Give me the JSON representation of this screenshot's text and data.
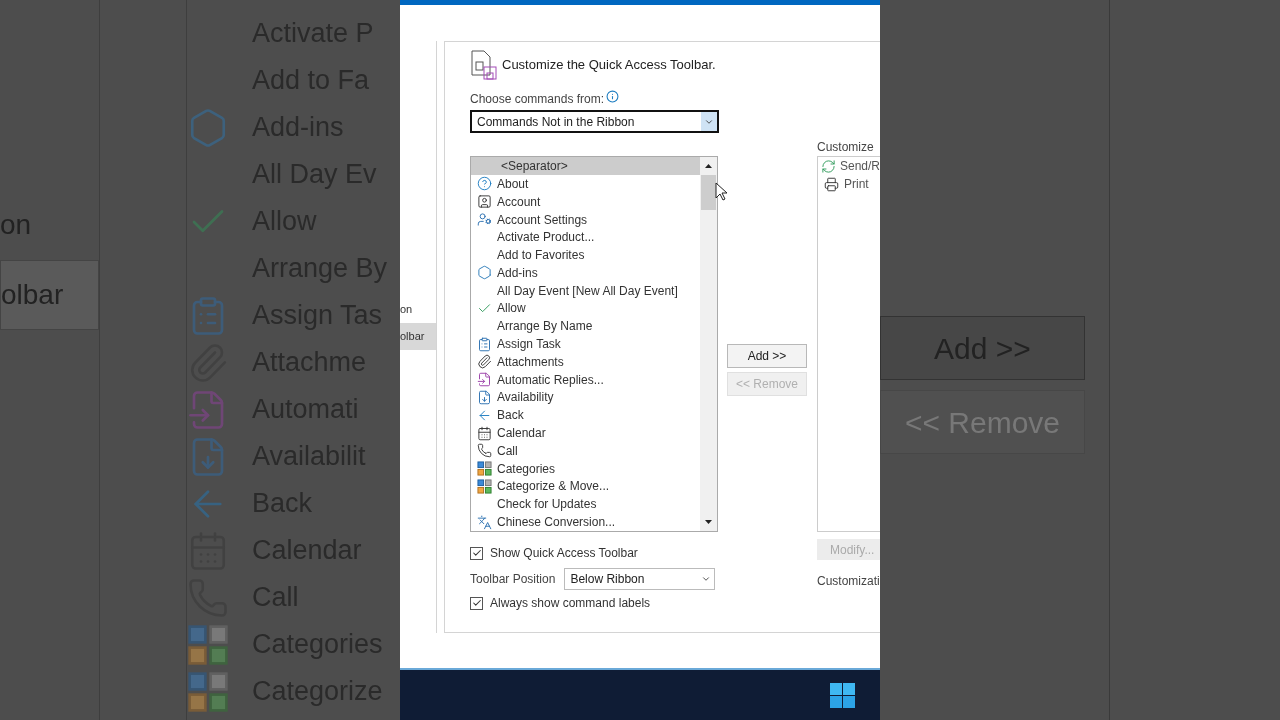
{
  "backdrop_left": {
    "nav_items": [
      {
        "label": "on",
        "selected": false
      },
      {
        "label": "olbar",
        "selected": true
      }
    ],
    "commands": [
      {
        "kind": "none",
        "label": "Activate P"
      },
      {
        "kind": "none",
        "label": "Add to Fa"
      },
      {
        "kind": "addin",
        "label": "Add-ins"
      },
      {
        "kind": "none",
        "label": "All Day Ev"
      },
      {
        "kind": "check",
        "label": "Allow"
      },
      {
        "kind": "none",
        "label": "Arrange By"
      },
      {
        "kind": "assign",
        "label": "Assign Tas"
      },
      {
        "kind": "clip",
        "label": "Attachme"
      },
      {
        "kind": "reply",
        "label": "Automati"
      },
      {
        "kind": "availability",
        "label": "Availabilit"
      },
      {
        "kind": "back",
        "label": "Back"
      },
      {
        "kind": "calendar",
        "label": "Calendar"
      },
      {
        "kind": "call",
        "label": "Call"
      },
      {
        "kind": "categories",
        "label": "Categories"
      },
      {
        "kind": "categories",
        "label": "Categorize"
      }
    ]
  },
  "dialog": {
    "nav_items": [
      {
        "label": "on",
        "selected": false
      },
      {
        "label": "olbar",
        "selected": true
      }
    ],
    "title": "Customize the Quick Access Toolbar.",
    "choose_label": "Choose commands from:",
    "choose_value": "Commands Not in the Ribbon",
    "commands": [
      {
        "kind": "none",
        "label": "<Separator>",
        "selected": true
      },
      {
        "kind": "help",
        "label": "About",
        "selected": false
      },
      {
        "kind": "person",
        "label": "Account",
        "selected": false
      },
      {
        "kind": "person-gear",
        "label": "Account Settings",
        "selected": false
      },
      {
        "kind": "none",
        "label": "Activate Product...",
        "selected": false
      },
      {
        "kind": "none",
        "label": "Add to Favorites",
        "selected": false
      },
      {
        "kind": "addin",
        "label": "Add-ins",
        "selected": false
      },
      {
        "kind": "none",
        "label": "All Day Event [New All Day Event]",
        "selected": false
      },
      {
        "kind": "check",
        "label": "Allow",
        "selected": false
      },
      {
        "kind": "none",
        "label": "Arrange By Name",
        "selected": false
      },
      {
        "kind": "assign",
        "label": "Assign Task",
        "selected": false
      },
      {
        "kind": "clip",
        "label": "Attachments",
        "selected": false
      },
      {
        "kind": "reply",
        "label": "Automatic Replies...",
        "selected": false
      },
      {
        "kind": "availability",
        "label": "Availability",
        "selected": false
      },
      {
        "kind": "back",
        "label": "Back",
        "selected": false
      },
      {
        "kind": "calendar",
        "label": "Calendar",
        "selected": false
      },
      {
        "kind": "call",
        "label": "Call",
        "selected": false
      },
      {
        "kind": "categories",
        "label": "Categories",
        "selected": false
      },
      {
        "kind": "categories",
        "label": "Categorize & Move...",
        "selected": false
      },
      {
        "kind": "none",
        "label": "Check for Updates",
        "selected": false
      },
      {
        "kind": "chinese",
        "label": "Chinese Conversion...",
        "selected": false
      }
    ],
    "buttons": [
      {
        "label": "Add >>",
        "disabled": false
      },
      {
        "label": "<< Remove",
        "disabled": true
      }
    ],
    "toolbar_label": "Customize",
    "toolbar_items": [
      {
        "kind": "refresh",
        "label": "Send/R"
      },
      {
        "kind": "print",
        "label": "Print"
      }
    ],
    "modify_button": {
      "label": "Modify...",
      "disabled": true
    },
    "customizations_label": "Customizati",
    "show_toolbar": {
      "label": "Show Quick Access Toolbar",
      "checked": true
    },
    "position_label": "Toolbar Position",
    "position_value": "Below Ribbon",
    "show_labels": {
      "label": "Always show command labels",
      "checked": true
    }
  },
  "backdrop_right": {
    "buttons": [
      {
        "label": "Add >>",
        "disabled": false
      },
      {
        "label": "<< Remove",
        "disabled": true
      }
    ]
  }
}
